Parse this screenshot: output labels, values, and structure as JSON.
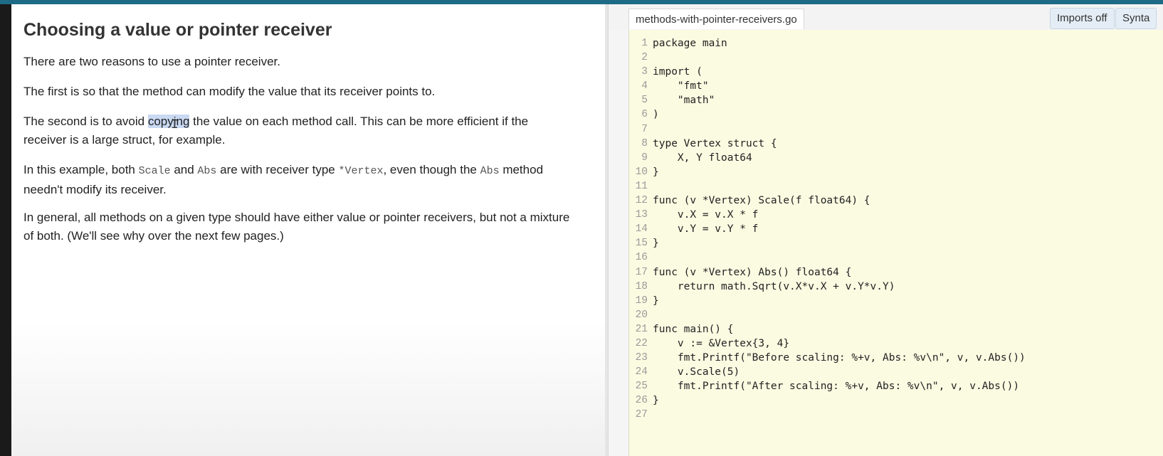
{
  "lesson": {
    "title": "Choosing a value or pointer receiver",
    "p1": "There are two reasons to use a pointer receiver.",
    "p2": "The first is so that the method can modify the value that its receiver points to.",
    "p3": {
      "before": "The second is to avoid ",
      "highlight": "copying",
      "after": " the value on each method call. This can be more efficient if the receiver is a large struct, for example."
    },
    "p4": {
      "t1": "In this example, both ",
      "c1": "Scale",
      "t2": " and ",
      "c2": "Abs",
      "t3": " are with receiver type ",
      "c3": "*Vertex",
      "t4": ", even though the ",
      "c4": "Abs",
      "t5": " method needn't modify its receiver."
    },
    "p5": "In general, all methods on a given type should have either value or pointer receivers, but not a mixture of both. (We'll see why over the next few pages.)"
  },
  "editor": {
    "file_tab": "methods-with-pointer-receivers.go",
    "imports_button": "Imports off",
    "syntax_button": "Synta",
    "line_numbers": [
      "1",
      "2",
      "3",
      "4",
      "5",
      "6",
      "7",
      "8",
      "9",
      "10",
      "11",
      "12",
      "13",
      "14",
      "15",
      "16",
      "17",
      "18",
      "19",
      "20",
      "21",
      "22",
      "23",
      "24",
      "25",
      "26",
      "27"
    ],
    "code_lines": [
      "package main",
      "",
      "import (",
      "    \"fmt\"",
      "    \"math\"",
      ")",
      "",
      "type Vertex struct {",
      "    X, Y float64",
      "}",
      "",
      "func (v *Vertex) Scale(f float64) {",
      "    v.X = v.X * f",
      "    v.Y = v.Y * f",
      "}",
      "",
      "func (v *Vertex) Abs() float64 {",
      "    return math.Sqrt(v.X*v.X + v.Y*v.Y)",
      "}",
      "",
      "func main() {",
      "    v := &Vertex{3, 4}",
      "    fmt.Printf(\"Before scaling: %+v, Abs: %v\\n\", v, v.Abs())",
      "    v.Scale(5)",
      "    fmt.Printf(\"After scaling: %+v, Abs: %v\\n\", v, v.Abs())",
      "}",
      ""
    ]
  },
  "colors": {
    "accent_bar": "#1d6b87",
    "code_background": "#fbfbe2",
    "selection": "#c9d9f2"
  }
}
